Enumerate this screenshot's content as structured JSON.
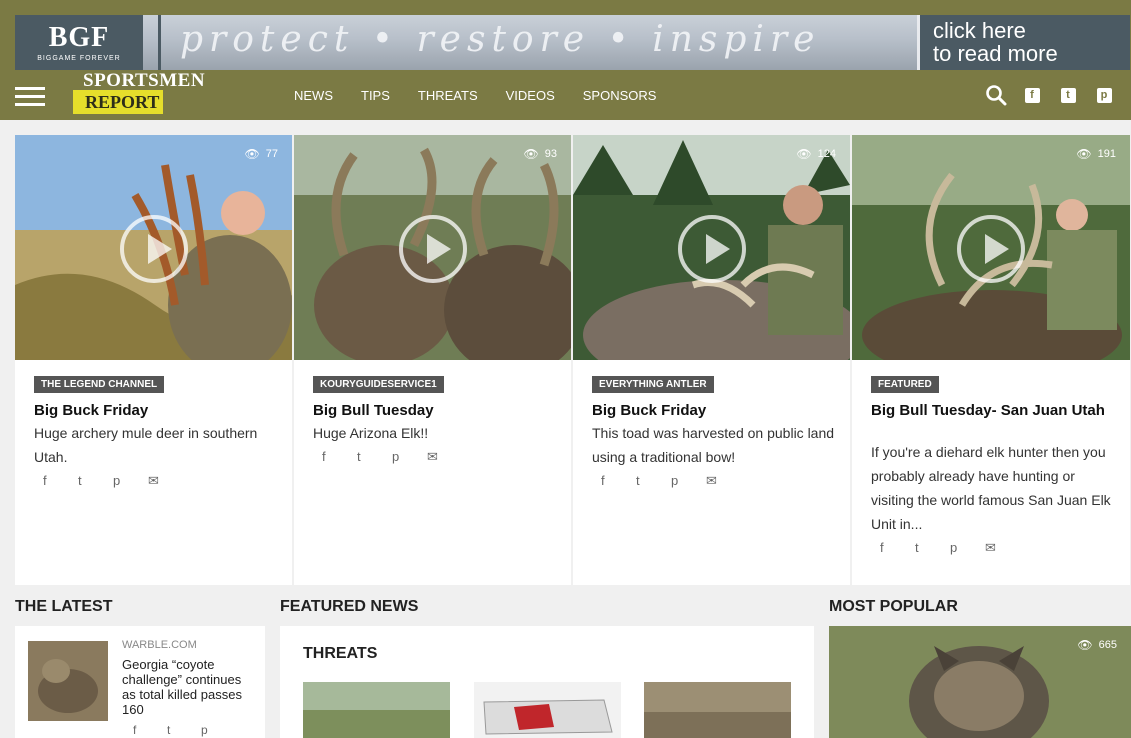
{
  "banner": {
    "logo_text": "BGF",
    "logo_subtext": "BIGGAME FOREVER",
    "tagline": "protect • restore • inspire",
    "cta_line1": "click here",
    "cta_line2": "to read more"
  },
  "site": {
    "logo_top": "SPORTSMEN",
    "logo_bottom": "REPORT"
  },
  "nav": {
    "items": [
      "NEWS",
      "TIPS",
      "THREATS",
      "VIDEOS",
      "SPONSORS"
    ]
  },
  "cards": [
    {
      "views": "77",
      "channel": "THE LEGEND CHANNEL",
      "title": "Big Buck Friday",
      "description": "Huge archery mule deer in southern Utah."
    },
    {
      "views": "93",
      "channel": "KOURYGUIDESERVICE1",
      "title": "Big Bull Tuesday",
      "description": "Huge Arizona Elk!!"
    },
    {
      "views": "124",
      "channel": "EVERYTHING ANTLER",
      "title": "Big Buck Friday",
      "description": "This toad was harvested on public land using a traditional bow!"
    },
    {
      "views": "191",
      "channel": "FEATURED",
      "title": "Big Bull Tuesday- San Juan Utah",
      "description": "If you're a diehard elk hunter then you probably already have hunting or visiting the world famous San Juan Elk Unit in..."
    }
  ],
  "sections": {
    "latest": "THE LATEST",
    "featured": "FEATURED NEWS",
    "popular": "MOST POPULAR"
  },
  "latest_item": {
    "source": "WARBLE.COM",
    "title": "Georgia “coyote challenge” continues as total killed passes 160"
  },
  "featured_news": {
    "category": "THREATS"
  },
  "popular_item": {
    "views": "665"
  },
  "colors": {
    "nav_bg": "#7b7a44",
    "logo_yellow": "#e6de2b",
    "badge_bg": "#555555"
  }
}
